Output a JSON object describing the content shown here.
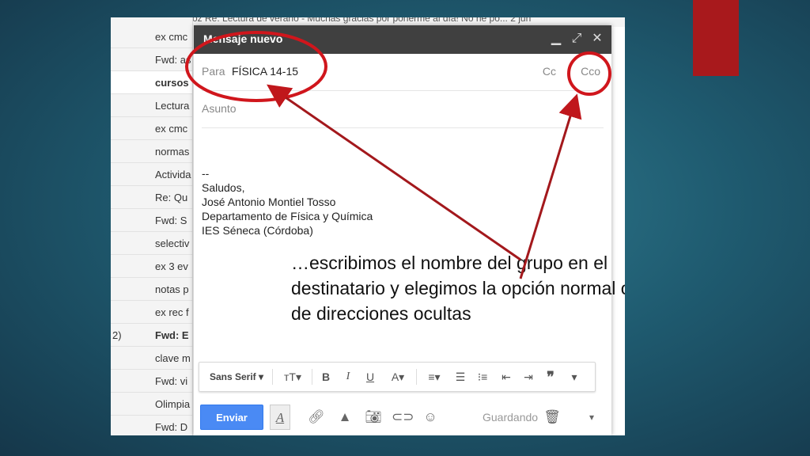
{
  "inbox": {
    "top_partial": "oz    Re: Lectura de verano - Muchas gracias por ponerme al día! No he po...     2 jun",
    "rows": [
      {
        "prefix": "",
        "subject": "ex cmc",
        "bold": false
      },
      {
        "prefix": "",
        "subject": "Fwd: as",
        "bold": false
      },
      {
        "prefix": "",
        "subject": "cursos",
        "bold": true
      },
      {
        "prefix": "",
        "subject": "Lectura",
        "bold": false
      },
      {
        "prefix": "",
        "subject": "ex cmc",
        "bold": false
      },
      {
        "prefix": "",
        "subject": "normas",
        "bold": false
      },
      {
        "prefix": "",
        "subject": "Activida",
        "bold": false
      },
      {
        "prefix": "",
        "subject": "Re: Qu",
        "bold": false
      },
      {
        "prefix": "",
        "subject": "Fwd: S",
        "bold": false
      },
      {
        "prefix": "",
        "subject": "selectiv",
        "bold": false
      },
      {
        "prefix": "",
        "subject": "ex 3 ev",
        "bold": false
      },
      {
        "prefix": "",
        "subject": "notas p",
        "bold": false
      },
      {
        "prefix": "",
        "subject": "ex rec f",
        "bold": false
      },
      {
        "prefix": "2)",
        "subject": "Fwd: E",
        "bold": true
      },
      {
        "prefix": "",
        "subject": "clave m",
        "bold": false
      },
      {
        "prefix": "",
        "subject": "Fwd: vi",
        "bold": false
      },
      {
        "prefix": "",
        "subject": "Olimpia",
        "bold": false
      },
      {
        "prefix": "",
        "subject": "Fwd: D",
        "bold": false
      }
    ]
  },
  "compose": {
    "title": "Mensaje nuevo",
    "to_label": "Para",
    "to_value": "FÍSICA 14-15",
    "cc_label": "Cc",
    "bcc_label": "Cco",
    "subject_placeholder": "Asunto",
    "signature": [
      "--",
      "Saludos,",
      "José Antonio Montiel Tosso",
      "Departamento de Física y Química",
      "IES Séneca (Córdoba)"
    ],
    "font_select": "Sans Serif",
    "send_label": "Enviar",
    "saving_label": "Guardando"
  },
  "annotation": {
    "text": "…escribimos el nombre del grupo en el destinatario y elegimos la opción normal o de direcciones ocultas",
    "color": "#c0171c"
  },
  "icons": {
    "minimize": "minimize-icon",
    "expand": "expand-icon",
    "close": "close-icon"
  }
}
